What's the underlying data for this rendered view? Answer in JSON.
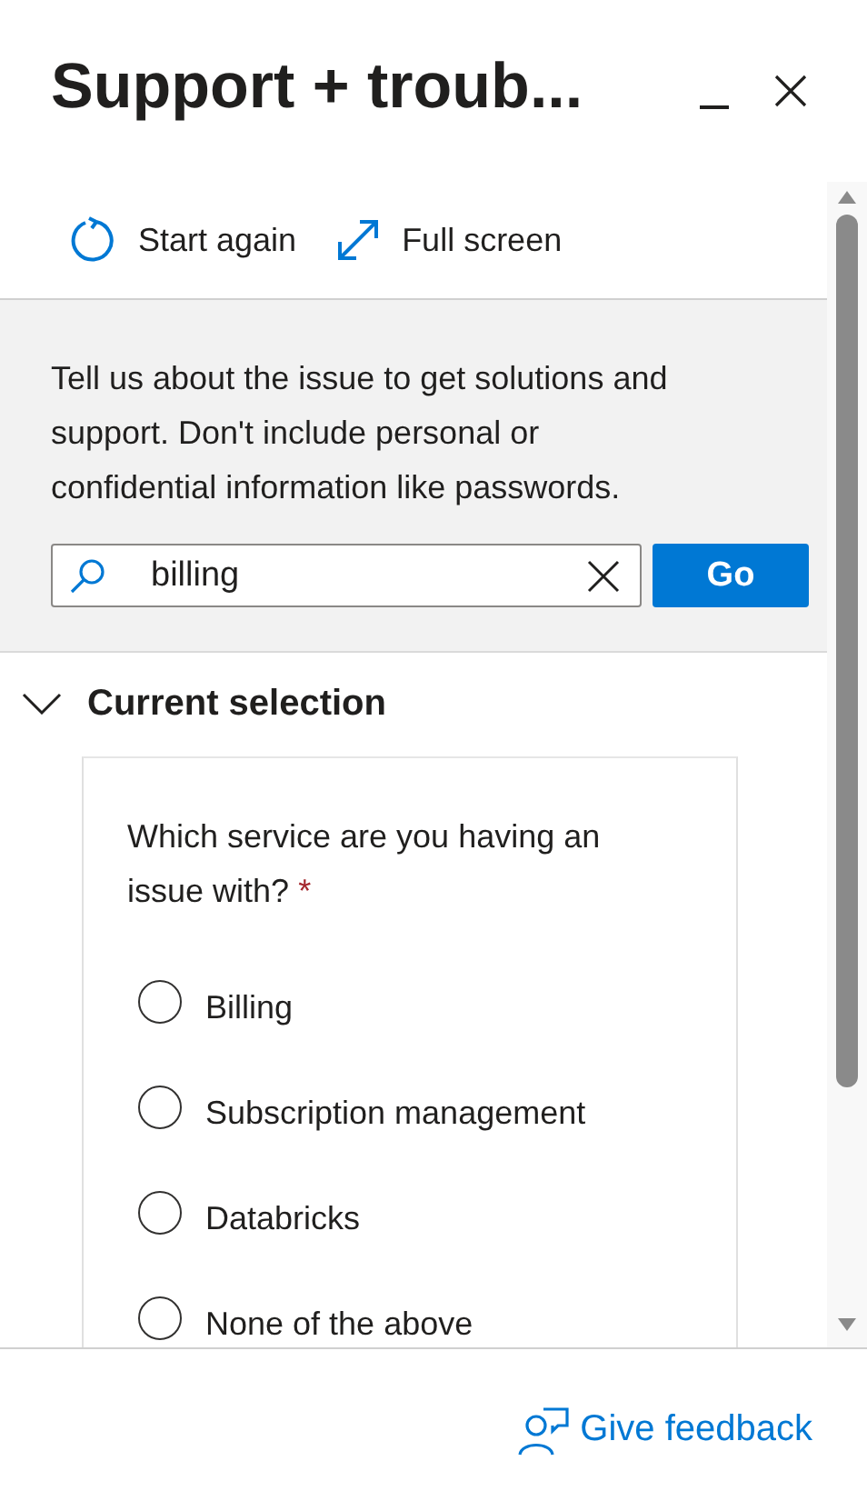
{
  "window": {
    "title": "Support + troub..."
  },
  "toolbar": [
    {
      "kind": "restart",
      "label": "Start again"
    },
    {
      "kind": "expand",
      "label": "Full screen"
    }
  ],
  "intro": "Tell us about the issue to get solutions and support. Don't include personal or confidential information like passwords.",
  "search": {
    "value": "billing",
    "button": "Go"
  },
  "section": {
    "title": "Current selection",
    "expanded": true,
    "question": "Which service are you having an issue with?",
    "required_mark": "*",
    "options": [
      {
        "label": "Billing",
        "selected": false
      },
      {
        "label": "Subscription management",
        "selected": false
      },
      {
        "label": "Databricks",
        "selected": false
      },
      {
        "label": "None of the above",
        "selected": false
      }
    ]
  },
  "footer": {
    "link": "Give feedback"
  }
}
